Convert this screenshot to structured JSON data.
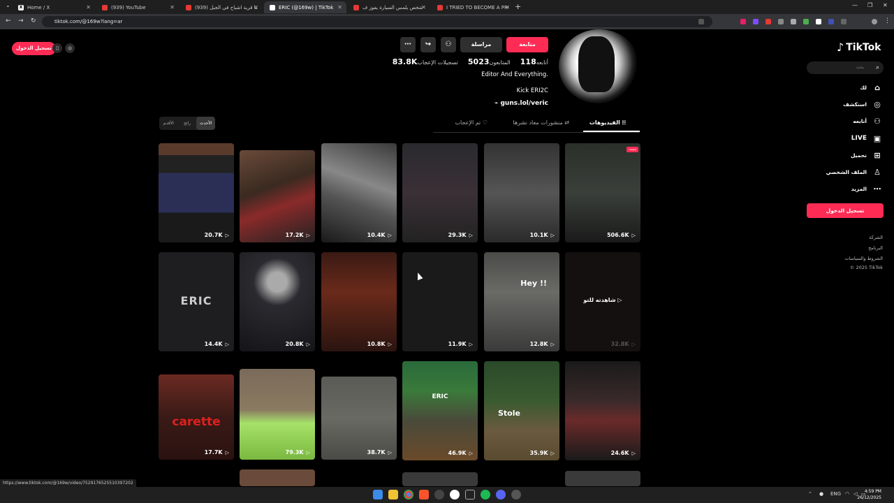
{
  "browser": {
    "tabs": [
      {
        "title": "Home / X",
        "icon": "x-icon"
      },
      {
        "title": "(939) YouTube",
        "icon": "youtube-icon"
      },
      {
        "title": "(939) دخلنا قرية اشباح في الجبل",
        "icon": "youtube-icon"
      },
      {
        "title": "ERIC (@169w) | TikTok",
        "icon": "tiktok-icon"
      },
      {
        "title": "اول شخص يلمس السيارة يفوز ف...",
        "icon": "youtube-icon"
      },
      {
        "title": "I TRIED TO BECOME A PROFESS...",
        "icon": "youtube-icon"
      }
    ],
    "new_tab": "+",
    "url": "tiktok.com/@169w?lang=ar",
    "status_url": "https://www.tiktok.com/@169w/video/7529176525510397202"
  },
  "float": {
    "login": "تسجيل الدخول"
  },
  "profile": {
    "follow": "متابعة",
    "message": "مراسلة",
    "stats": {
      "following_value": "118",
      "following_label": "أتابعه",
      "followers_value": "5023",
      "followers_label": "المتابعون",
      "likes_value": "83.8K",
      "likes_label": "تسجيلات الإعجاب"
    },
    "bio_line1": "Editor And Everything.",
    "bio_line2": "Kick ERI2C",
    "link": "guns.lol/veric"
  },
  "tabs": {
    "videos": "الفيديوهات",
    "reposts": "منشورات معاد نشرها",
    "liked": "تم الإعجاب"
  },
  "sort": {
    "latest": "الأحدث",
    "popular": "رائج",
    "oldest": "الأقدم"
  },
  "videos": [
    {
      "views": "20.7K"
    },
    {
      "views": "17.2K"
    },
    {
      "views": "10.4K"
    },
    {
      "views": "29.3K"
    },
    {
      "views": "10.1K"
    },
    {
      "views": "506.6K",
      "badge": "مثبت"
    },
    {
      "views": "14.4K",
      "text": "ERIC"
    },
    {
      "views": "20.8K"
    },
    {
      "views": "10.8K"
    },
    {
      "views": "11.9K"
    },
    {
      "views": "12.8K",
      "text": "Hey !!"
    },
    {
      "views": "32.8K",
      "text": "شاهدته للتو"
    },
    {
      "views": "17.7K",
      "text": "carette"
    },
    {
      "views": "79.3K"
    },
    {
      "views": "38.7K"
    },
    {
      "views": "46.9K",
      "text": "ERIC"
    },
    {
      "views": "35.9K",
      "text": "Stole"
    },
    {
      "views": "24.6K"
    }
  ],
  "sidebar": {
    "logo": "TikTok",
    "search_placeholder": "بحث",
    "items": [
      {
        "label": "لك",
        "icon": "home-icon"
      },
      {
        "label": "استكشف",
        "icon": "compass-icon"
      },
      {
        "label": "أتابعه",
        "icon": "user-plus-icon"
      },
      {
        "label": "LIVE",
        "icon": "live-icon"
      },
      {
        "label": "تحميل",
        "icon": "upload-icon"
      },
      {
        "label": "الملف الشخصي",
        "icon": "profile-icon"
      },
      {
        "label": "المزيد",
        "icon": "more-icon"
      }
    ],
    "login": "تسجيل الدخول",
    "footer": [
      "الشركة",
      "البرنامج",
      "الشروط والسياسات",
      "© 2025 TikTok"
    ]
  },
  "taskbar": {
    "lang": "ENG",
    "time": "4:59 PM",
    "date": "26/12/2025"
  },
  "colors": {
    "accent": "#fe2c55",
    "background": "#000000"
  }
}
